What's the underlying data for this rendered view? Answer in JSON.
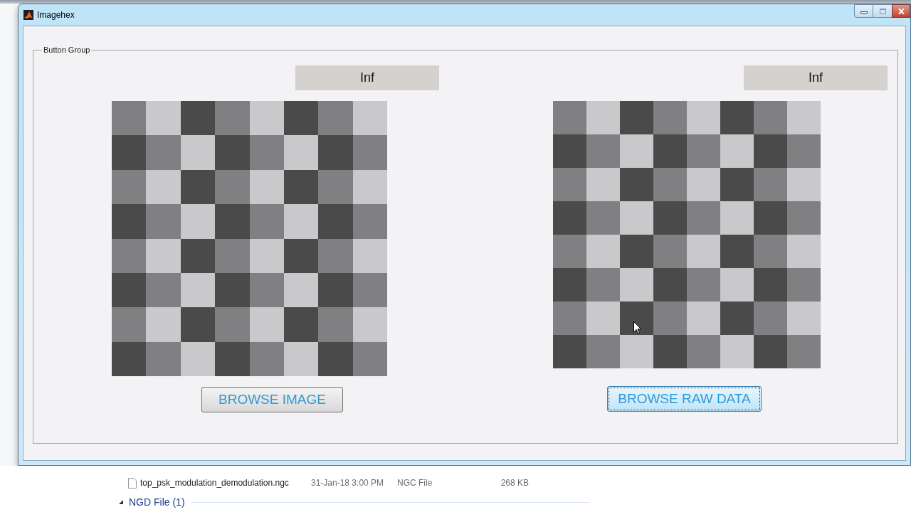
{
  "window": {
    "title": "Imagehex"
  },
  "panel": {
    "title": "Button Group",
    "columns": [
      {
        "readout": "Inf",
        "button": {
          "label": "BROWSE IMAGE",
          "focused": false
        }
      },
      {
        "readout": "Inf",
        "button": {
          "label": "BROWSE RAW DATA",
          "focused": true
        }
      }
    ]
  },
  "explorer": {
    "rows": [
      {
        "kind": "file",
        "name": "top_psk_modulation_demodulation.ngc",
        "date_modified": "31-Jan-18 3:00 PM",
        "type": "NGC File",
        "size": "268 KB"
      },
      {
        "kind": "group",
        "label": "NGD File (1)",
        "expanded": true
      }
    ]
  }
}
